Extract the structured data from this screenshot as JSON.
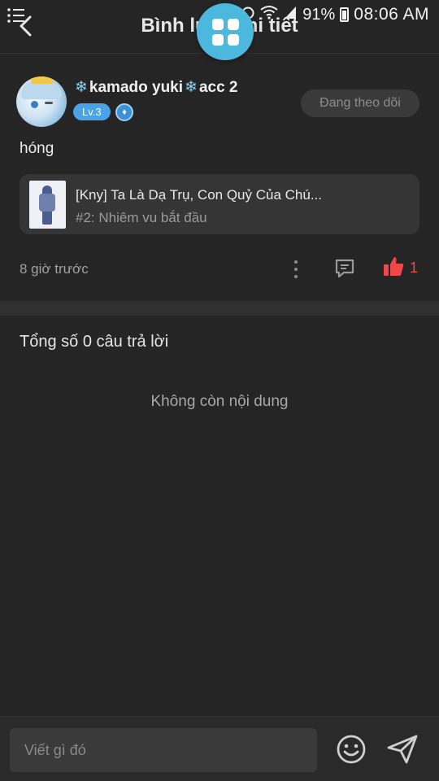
{
  "status_bar": {
    "battery_pct": "91%",
    "time": "08:06 AM"
  },
  "header": {
    "title": "Bình luận chi tiết"
  },
  "comment": {
    "username_prefix": "kamado yuki",
    "username_suffix": "acc 2",
    "level": "Lv.3",
    "follow_label": "Đang theo dõi",
    "text": "hóng",
    "reference": {
      "title": "[Kny] Ta Là Dạ Trụ, Con Quỷ Của Chú...",
      "subtitle": "#2: Nhiêm vu bắt đầu"
    },
    "timestamp": "8 giờ trước",
    "like_count": "1"
  },
  "replies": {
    "count_label": "Tổng số 0 câu trả lời",
    "empty_label": "Không còn nội dung"
  },
  "composer": {
    "placeholder": "Viết gì đó"
  },
  "colors": {
    "background": "#252525",
    "accent": "#4cb8de",
    "level_badge": "#4aa3e6",
    "like": "#f04848"
  }
}
